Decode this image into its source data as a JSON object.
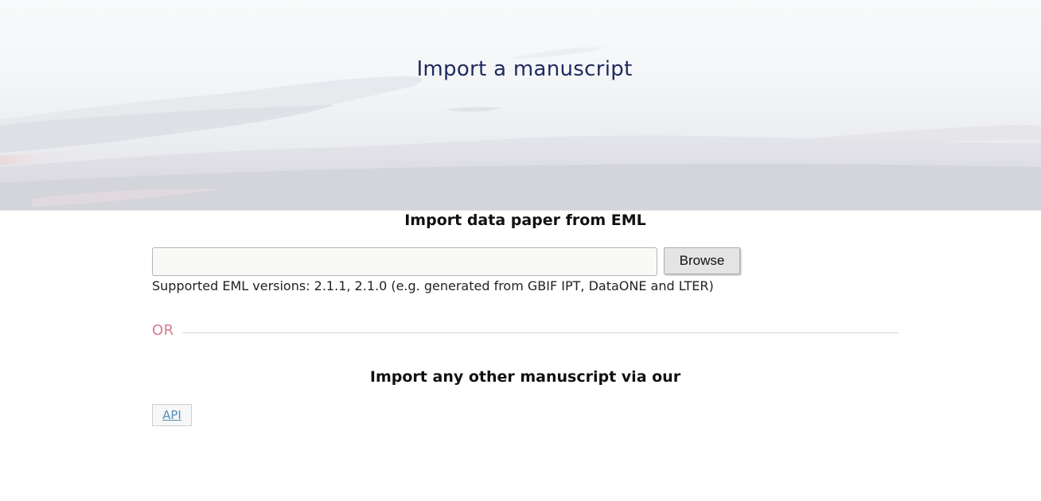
{
  "hero": {
    "title": "Import a manuscript"
  },
  "eml_section": {
    "title": "Import data paper from EML",
    "file_input_value": "",
    "browse_label": "Browse",
    "supported_text": "Supported EML versions: 2.1.1, 2.1.0 (e.g. generated from GBIF IPT, DataONE and LTER)"
  },
  "divider": {
    "label": "OR"
  },
  "other_section": {
    "title": "Import any other manuscript via our",
    "api_label": "API"
  },
  "colors": {
    "title_text": "#1f2a5e",
    "or_accent": "#d47b8f",
    "link": "#5a8fb5"
  }
}
